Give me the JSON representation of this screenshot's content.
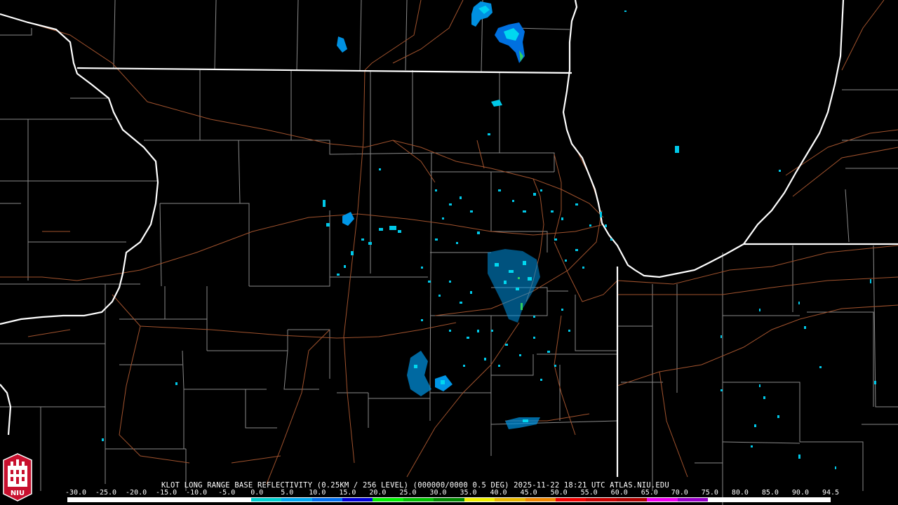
{
  "title": "KLOT LONG RANGE BASE REFLECTIVITY (0.25KM / 256 LEVEL) (000000/0000 0.5 DEG) 2025-11-22 18:21 UTC  ATLAS.NIU.EDU",
  "scale": {
    "labels": [
      "-30.0",
      "-25.0",
      "-20.0",
      "-15.0",
      "-10.0",
      "-5.0",
      "0.0",
      "5.0",
      "10.0",
      "15.0",
      "20.0",
      "25.0",
      "30.0",
      "35.0",
      "40.0",
      "45.0",
      "50.0",
      "55.0",
      "60.0",
      "65.0",
      "70.0",
      "75.0",
      "80.0",
      "85.0",
      "90.0",
      "94.5"
    ],
    "colors": [
      "#ffffff",
      "#ffffff",
      "#ffffff",
      "#ffffff",
      "#ffffff",
      "#ffffff",
      "#00d0d0",
      "#00a8f0",
      "#0070f0",
      "#0000d8",
      "#00f000",
      "#00c000",
      "#008800",
      "#f0f000",
      "#e8b800",
      "#f08800",
      "#f00000",
      "#c80000",
      "#b00000",
      "#f000f0",
      "#9800c8",
      "#ffffff",
      "#ffffff",
      "#ffffff",
      "#ffffff"
    ]
  },
  "logo": {
    "text": "NIU",
    "color": "#c8102e"
  },
  "map_colors": {
    "state_border": "#ffffff",
    "county_line": "#8a8a8a",
    "highway": "#a0522d",
    "echo_light": "#00c8e8",
    "echo_mid": "#0096e6",
    "echo_green": "#30d060"
  }
}
